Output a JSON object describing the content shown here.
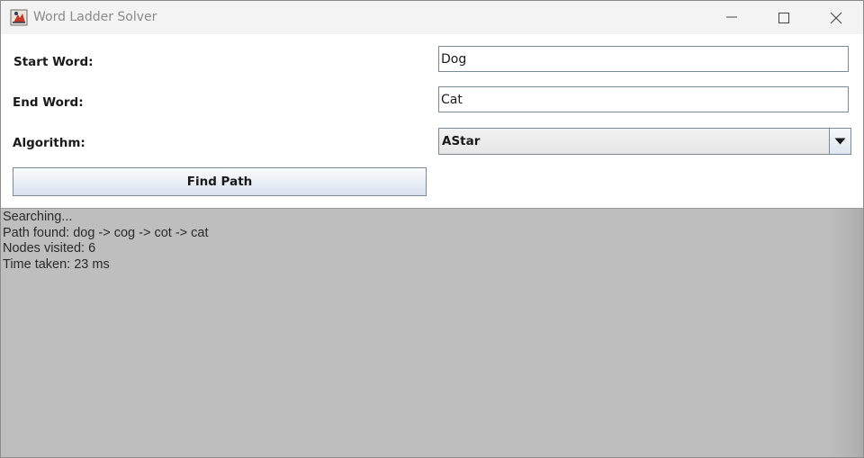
{
  "window": {
    "title": "Word Ladder Solver",
    "icon": "java-app-icon"
  },
  "form": {
    "start_label": "Start Word:",
    "start_value": "Dog",
    "end_label": "End Word:",
    "end_value": "Cat",
    "algorithm_label": "Algorithm:",
    "algorithm_selected": "AStar",
    "find_button": "Find Path"
  },
  "output": {
    "lines": [
      "Searching...",
      "Path found: dog -> cog -> cot -> cat",
      "Nodes visited: 6",
      "Time taken: 23 ms"
    ]
  },
  "colors": {
    "titlebar": "#f3f3f3",
    "output_bg": "#bebebe",
    "field_border": "#7a8a99"
  }
}
